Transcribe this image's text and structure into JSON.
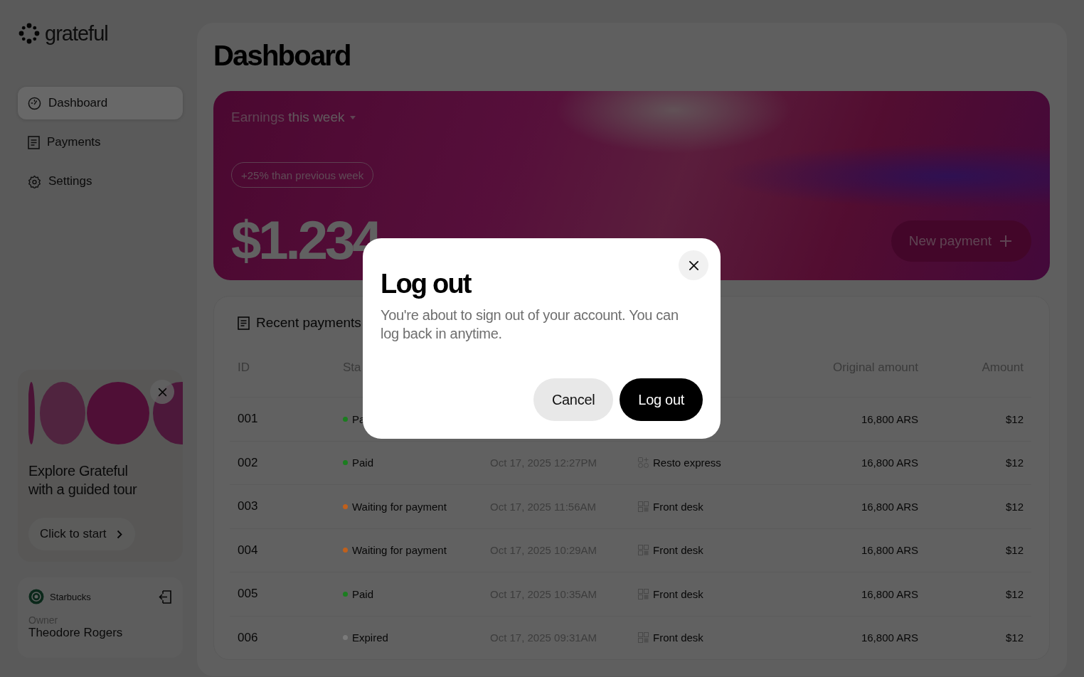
{
  "sidebar": {
    "logo": "grateful",
    "nav": [
      {
        "label": "Dashboard",
        "selected": true
      },
      {
        "label": "Payments",
        "selected": false
      },
      {
        "label": "Settings",
        "selected": false
      }
    ],
    "tour": {
      "title": "Explore Grateful with a guided tour",
      "button": "Click to start"
    },
    "account": {
      "business": "Starbucks",
      "role": "Owner",
      "name": "Theodore Rogers"
    }
  },
  "page_title": "Dashboard",
  "earnings": {
    "label": "Earnings",
    "period": "this week",
    "change": "+25% than previous week",
    "amount": "$1.234",
    "button": "New payment"
  },
  "payments": {
    "title": "Recent payments",
    "columns": [
      "ID",
      "Sta",
      "Original amount",
      "Amount"
    ],
    "rows": [
      {
        "id": "001",
        "status": "Pa",
        "color": "#1b7d1f",
        "original_amount": "16,800 ARS",
        "amount": "$12"
      },
      {
        "id": "002",
        "status": "Paid",
        "color": "#1b7d1f",
        "date": "Oct 17, 2025 12:27PM",
        "source": "Resto express",
        "kind": "app",
        "original_amount": "16,800 ARS",
        "amount": "$12"
      },
      {
        "id": "003",
        "status": "Waiting for payment",
        "color": "#c0601c",
        "date": "Oct 17, 2025 11:56AM",
        "source": "Front desk",
        "kind": "qr",
        "original_amount": "16,800 ARS",
        "amount": "$12"
      },
      {
        "id": "004",
        "status": "Waiting for payment",
        "color": "#c0601c",
        "date": "Oct 17, 2025 10:29AM",
        "source": "Front desk",
        "kind": "qr",
        "original_amount": "16,800 ARS",
        "amount": "$12"
      },
      {
        "id": "005",
        "status": "Paid",
        "color": "#1b7d1f",
        "date": "Oct 17, 2025 10:35AM",
        "source": "Front desk",
        "kind": "qr",
        "original_amount": "16,800 ARS",
        "amount": "$12"
      },
      {
        "id": "006",
        "status": "Expired",
        "color": "#7a7a7a",
        "date": "Oct 17, 2025 09:31AM",
        "source": "Front desk",
        "kind": "qr",
        "original_amount": "16,800 ARS",
        "amount": "$12"
      }
    ]
  },
  "modal": {
    "title": "Log out",
    "message": "You're about to sign out of your account. You can log back in anytime.",
    "buttons": [
      "Cancel",
      "Log out"
    ]
  }
}
